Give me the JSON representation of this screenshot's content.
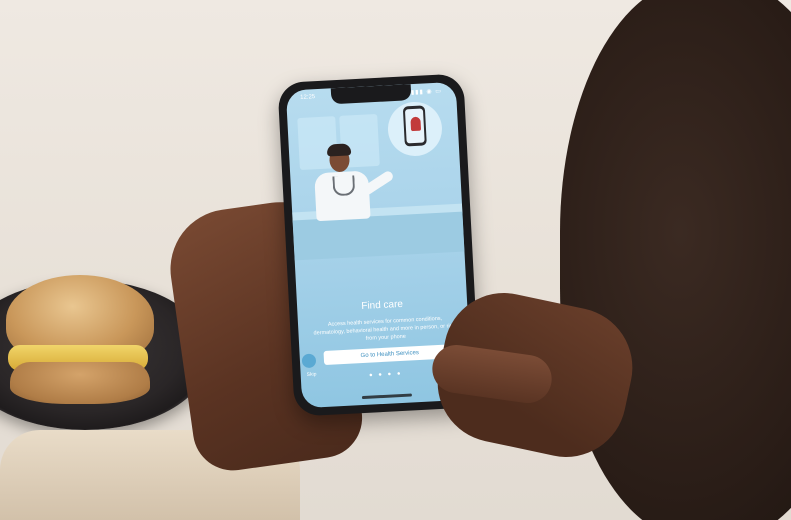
{
  "phone": {
    "status_time": "12:25",
    "status_icons": "▮▮▮ ◉ ▭",
    "title": "Find care",
    "description": "Access health services for common conditions, dermatology, behavioral health and more in person, or right from your phone",
    "cta_label": "Go to Health Services",
    "skip_label": "Skip",
    "pager": "● ● ● ●"
  },
  "colors": {
    "screen_blue": "#a9d3ea",
    "cta_text": "#3c8fbf",
    "background": "#ece6df"
  }
}
